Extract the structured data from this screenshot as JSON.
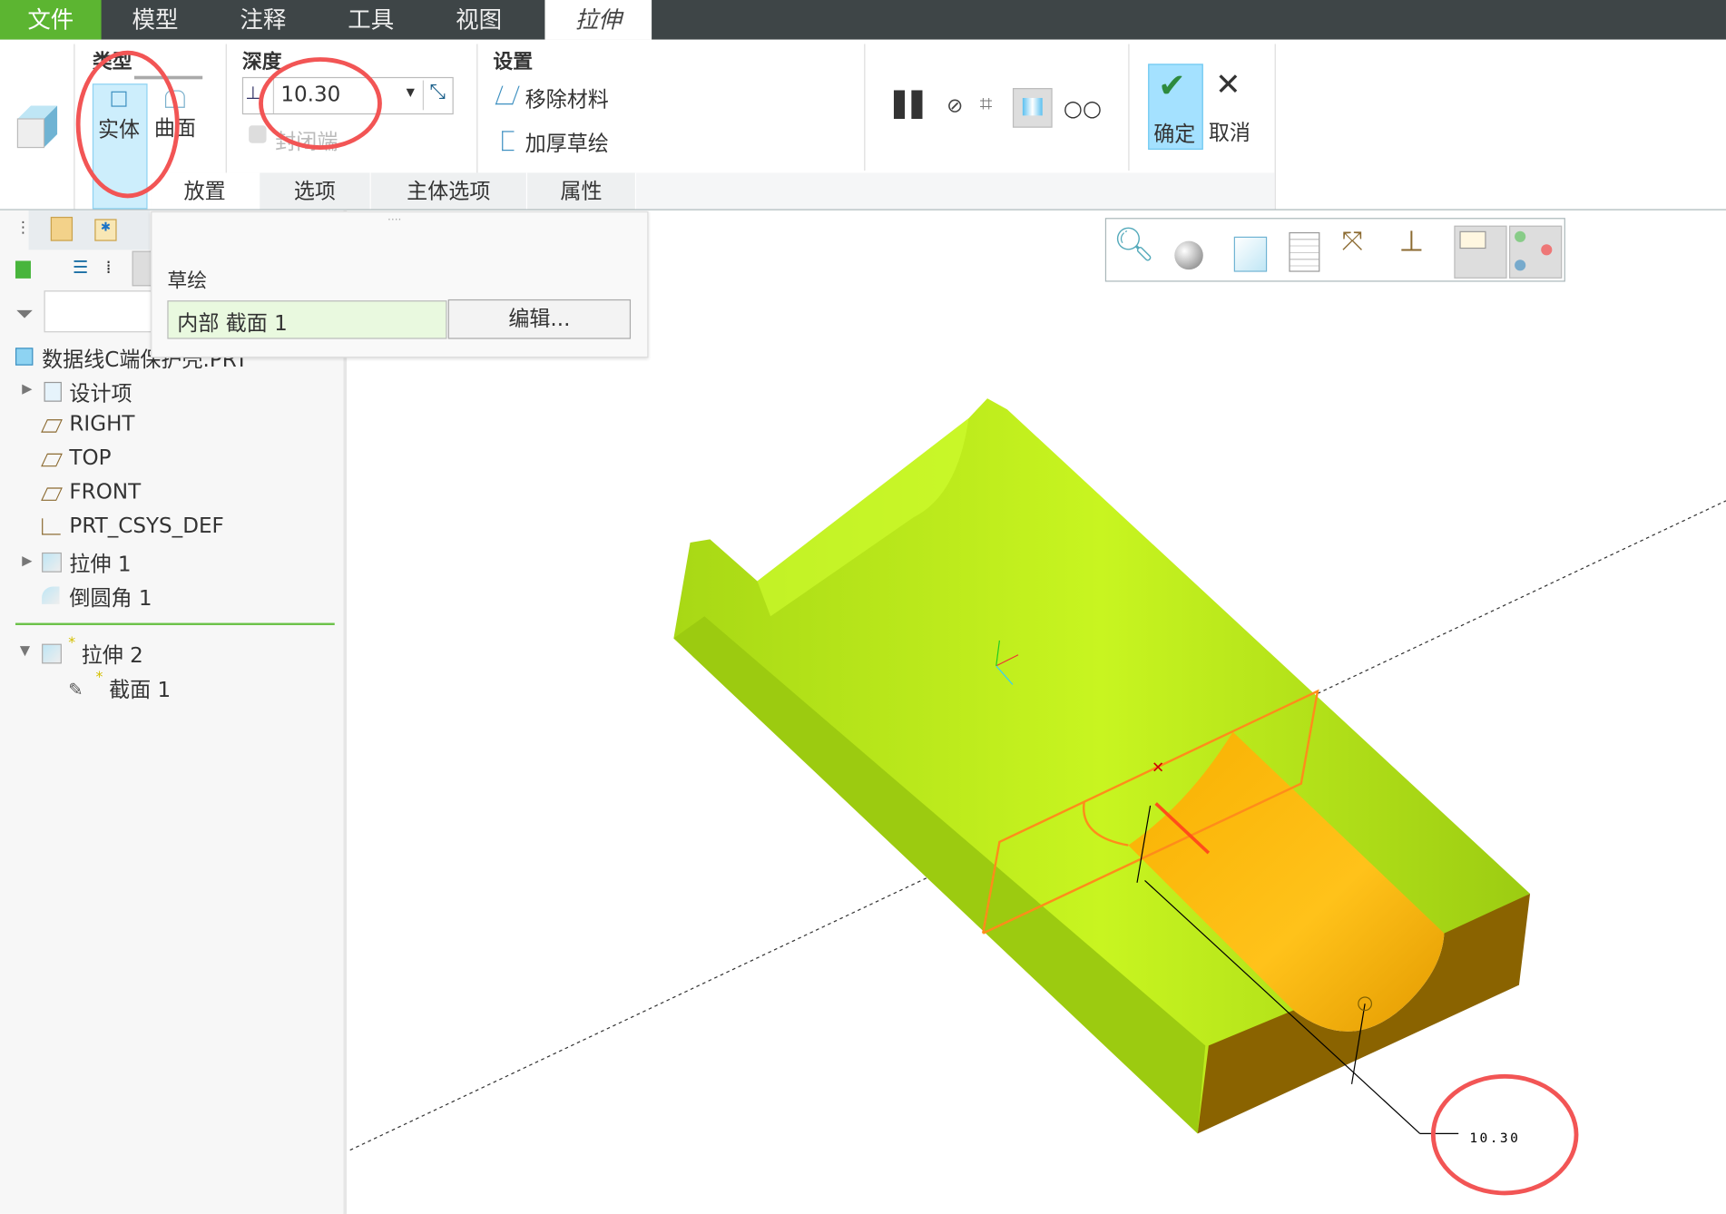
{
  "menu_tabs": {
    "file": "文件",
    "model": "模型",
    "annotate": "注释",
    "tools": "工具",
    "view": "视图",
    "extrude": "拉伸"
  },
  "ribbon": {
    "type_group": {
      "title": "类型",
      "solid": "实体",
      "surface": "曲面"
    },
    "depth_group": {
      "title": "深度",
      "value": "10.30",
      "capped_ends": "封闭端"
    },
    "settings_group": {
      "title": "设置",
      "remove_material": "移除材料",
      "thicken_sketch": "加厚草绘"
    },
    "ok": "确定",
    "cancel": "取消",
    "sub_tabs": [
      "放置",
      "选项",
      "主体选项",
      "属性"
    ]
  },
  "placement_panel": {
    "sketch_label": "草绘",
    "sketch_value": "内部 截面 1",
    "edit_button": "编辑..."
  },
  "model_tree": {
    "root": "数据线C端保护壳.PRT",
    "items": [
      "设计项",
      "RIGHT",
      "TOP",
      "FRONT",
      "PRT_CSYS_DEF",
      "拉伸 1",
      "倒圆角 1"
    ],
    "active_feature": "拉伸 2",
    "active_child": "截面 1",
    "new_marker": "*"
  },
  "graphics": {
    "dimension_value": "10.30"
  },
  "colors": {
    "file_tab": "#5cb531",
    "topbar": "#3e4547",
    "part": "#b5e61d",
    "preview": "#f5a800",
    "highlight": "#f25555"
  }
}
